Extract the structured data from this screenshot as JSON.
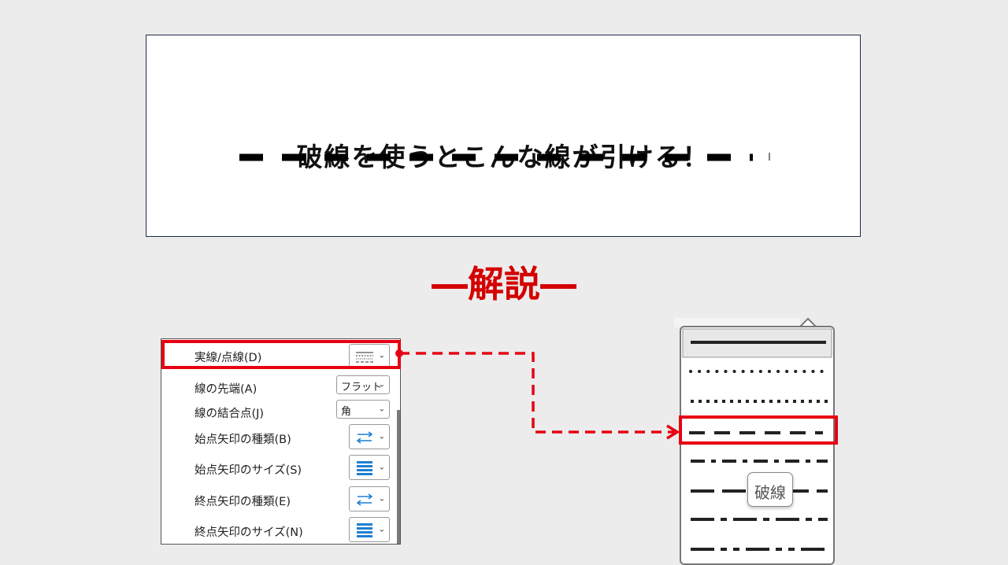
{
  "demo": {
    "title": "破線を使うとこんな線が引ける！"
  },
  "explain_heading": "―解説―",
  "panel": {
    "rows": [
      {
        "label": "実線/点線(D)",
        "control": "dash-style-icon"
      },
      {
        "label": "線の先端(A)",
        "value": "フラット"
      },
      {
        "label": "線の結合点(J)",
        "value": "角"
      },
      {
        "label": "始点矢印の種類(B)",
        "control": "arrow-type-icon"
      },
      {
        "label": "始点矢印のサイズ(S)",
        "control": "arrow-size-icon"
      },
      {
        "label": "終点矢印の種類(E)",
        "control": "arrow-type-icon"
      },
      {
        "label": "終点矢印のサイズ(N)",
        "control": "arrow-size-icon"
      }
    ]
  },
  "dash_menu": {
    "tooltip": "破線",
    "options": [
      "solid",
      "round-dot",
      "square-dot",
      "dash",
      "dash-dot",
      "long-dash",
      "long-dash-dot",
      "long-dash-dot-dot"
    ],
    "selected": "dash"
  },
  "colors": {
    "highlight": "#e60012",
    "accent_blue": "#1e7fd0"
  }
}
